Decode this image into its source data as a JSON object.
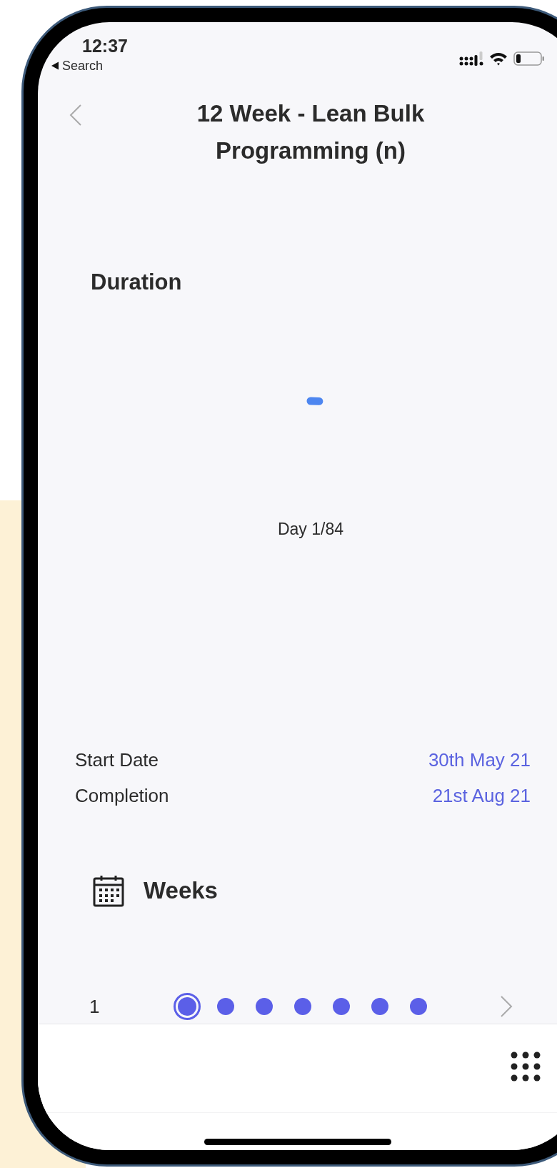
{
  "status_bar": {
    "time": "12:37",
    "back_link": "Search"
  },
  "header": {
    "title_lines": [
      "12 Week - Lean Bulk",
      "Programming (n)"
    ]
  },
  "duration": {
    "heading": "Duration",
    "progress": {
      "level": 0.01,
      "label": "Day 1/84"
    }
  },
  "dates": [
    {
      "label": "Start Date",
      "value": "30th May 21"
    },
    {
      "label": "Completion",
      "value": "21st Aug 21"
    }
  ],
  "weeks": {
    "heading": "Weeks",
    "rows": [
      {
        "number": "1",
        "days": [
          {
            "selected": true
          },
          {
            "selected": false
          },
          {
            "selected": false
          },
          {
            "selected": false
          },
          {
            "selected": false
          },
          {
            "selected": false
          },
          {
            "selected": false
          }
        ]
      }
    ]
  }
}
